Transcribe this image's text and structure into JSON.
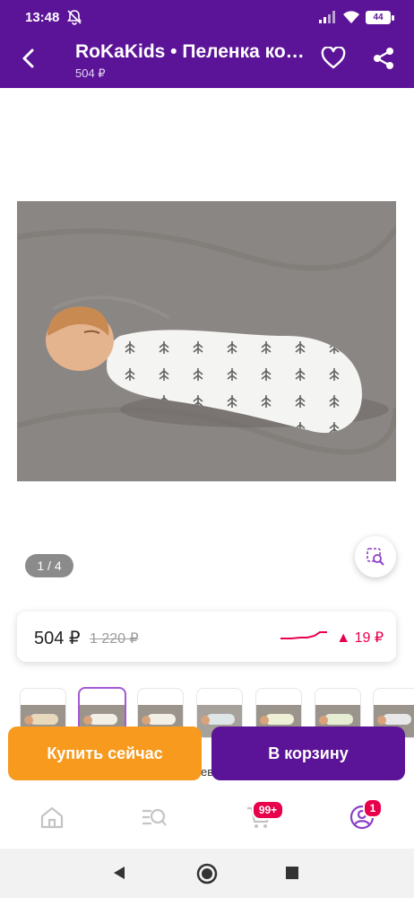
{
  "status_bar": {
    "time": "13:48",
    "battery": "44"
  },
  "header": {
    "title": "RoKaKids • Пеленка кокон на молнии",
    "price": "504 ₽"
  },
  "gallery": {
    "counter": "1 / 4",
    "total": 4,
    "current": 1
  },
  "price_card": {
    "current": "504 ₽",
    "old": "1 220 ₽",
    "change": "▲ 19 ₽",
    "trend_color": "#e8004d"
  },
  "thumbnails": {
    "count": 7,
    "selected_index": 1
  },
  "peek_text": "ев",
  "actions": {
    "buy_now": "Купить сейчас",
    "add_to_cart": "В корзину"
  },
  "bottom_nav": {
    "items": [
      "home-icon",
      "catalog-icon",
      "cart-icon",
      "profile-icon"
    ],
    "cart_badge": "99+",
    "profile_badge": "1"
  },
  "colors": {
    "brand": "#5b1497",
    "accent_orange": "#f79a1e",
    "alert": "#e8004d"
  }
}
